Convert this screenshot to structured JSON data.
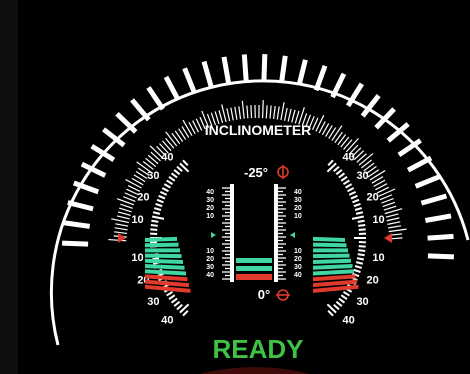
{
  "title": "INCLINOMETER",
  "status": "READY",
  "pitch": {
    "top": "-25°",
    "bottom": "0°"
  },
  "roll_scale_left": [
    "40",
    "30",
    "20",
    "10",
    "10",
    "20",
    "30",
    "40"
  ],
  "roll_scale_right": [
    "40",
    "30",
    "20",
    "10",
    "10",
    "20",
    "30",
    "40"
  ],
  "center_scale_left": [
    "40",
    "30",
    "20",
    "10",
    "10",
    "20",
    "30",
    "40"
  ],
  "center_scale_right": [
    "40",
    "30",
    "20",
    "10",
    "10",
    "20",
    "30",
    "40"
  ],
  "colors": {
    "accent_green": "#3fd6a4",
    "ready_green": "#3ec244",
    "alert_red": "#e03a2c",
    "background": "#000000",
    "ink": "#ffffff"
  }
}
